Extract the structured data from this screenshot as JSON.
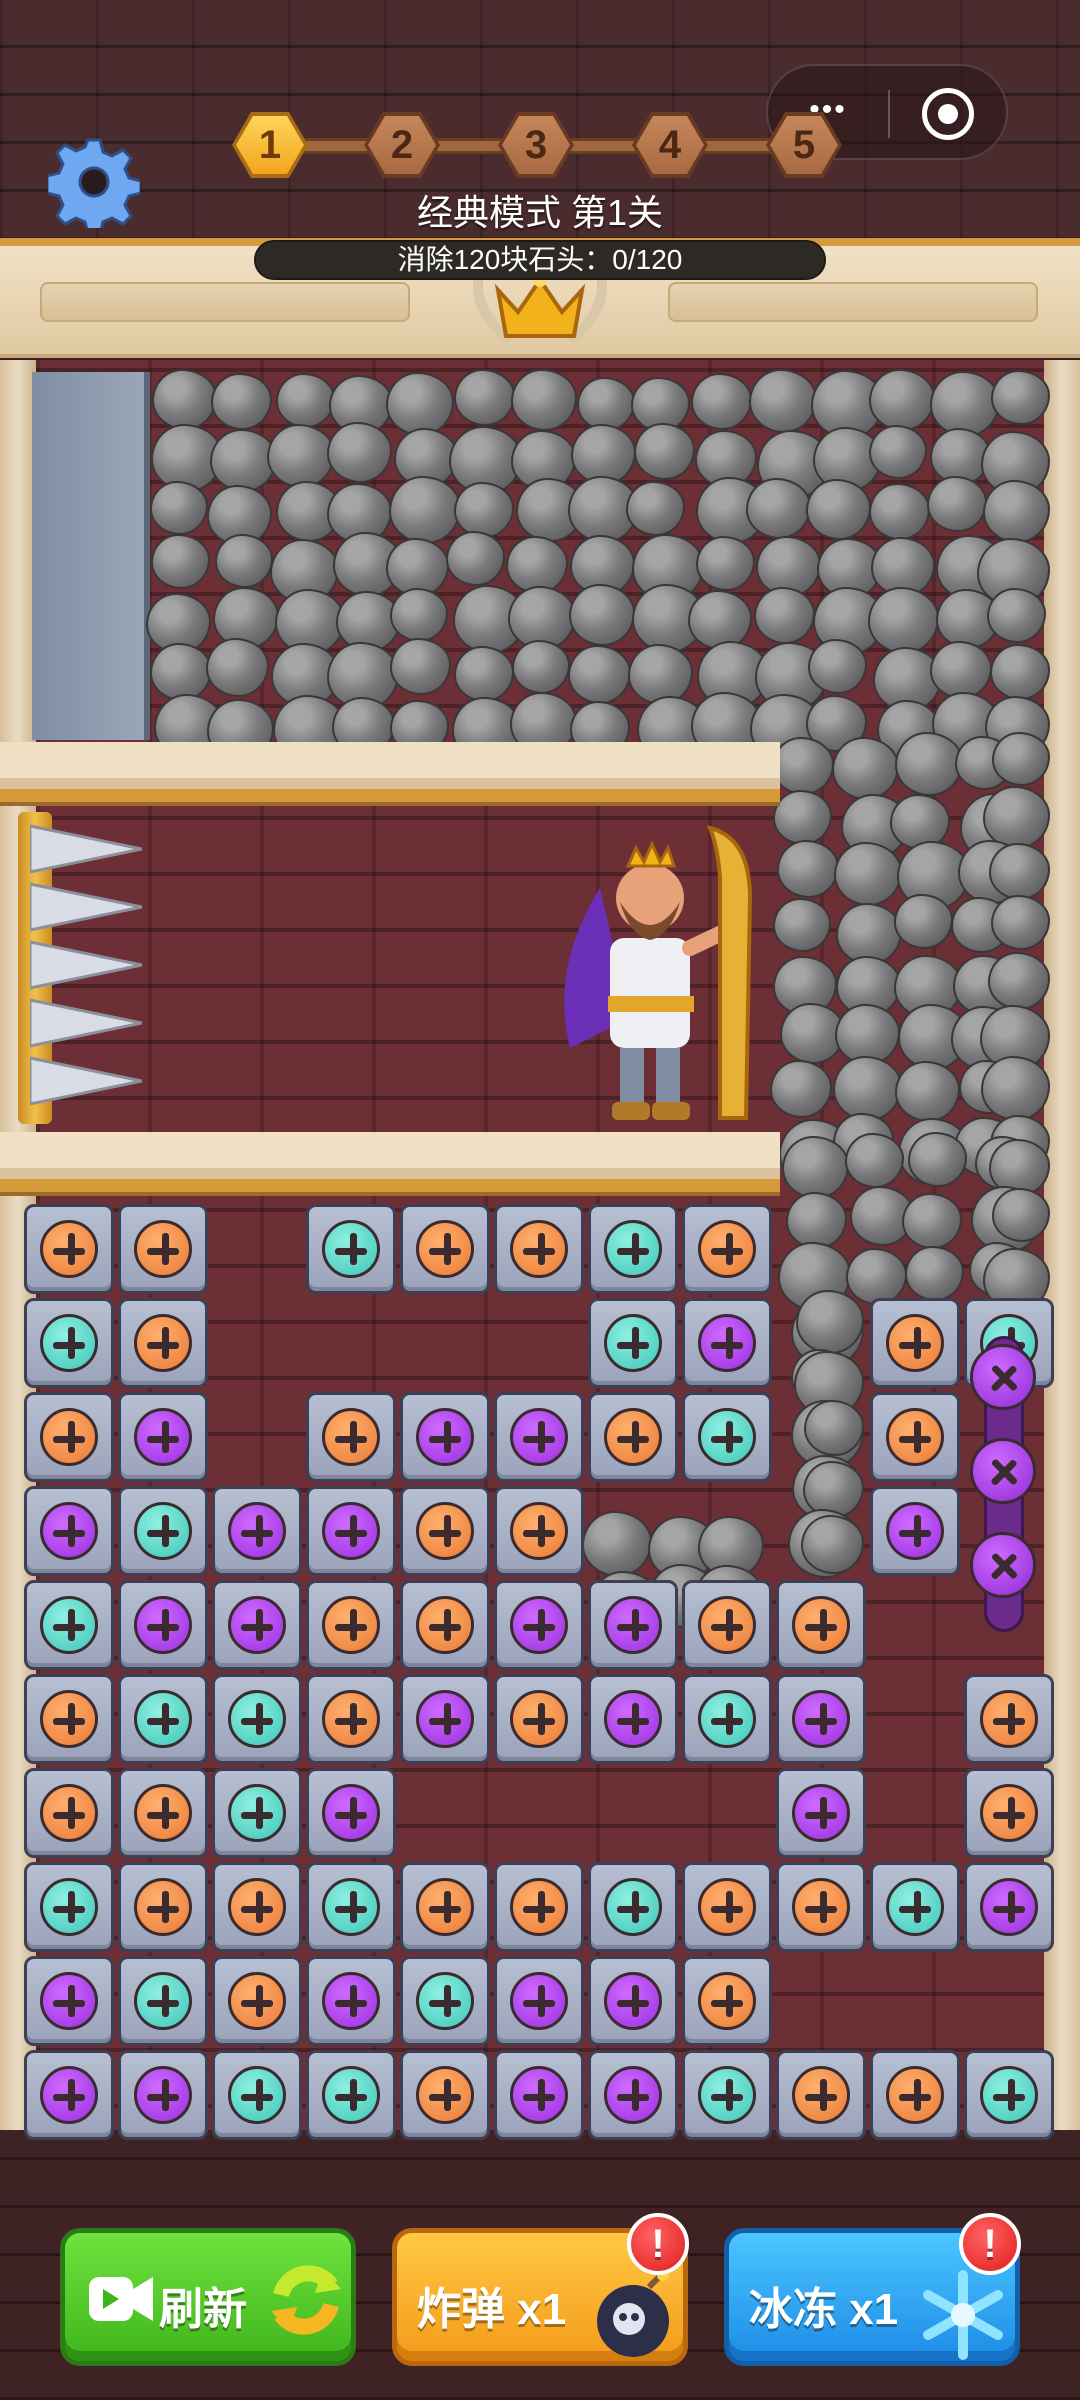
{
  "header": {
    "levels": [
      "1",
      "2",
      "3",
      "4",
      "5"
    ],
    "current_level": "1",
    "mode_title": "经典模式 第1关",
    "goal_text": "消除120块石头：0/120",
    "more_icon": "more-dots-icon",
    "close_icon": "target-close-icon",
    "settings_icon": "gear-icon"
  },
  "board": {
    "screw_colors": {
      "orange": "#ea7a36",
      "teal": "#3dc6b6",
      "purple": "#9a2fe0"
    },
    "rows": [
      [
        "orange",
        "orange",
        null,
        "teal",
        "orange",
        "orange",
        "teal",
        "orange",
        null,
        null,
        null
      ],
      [
        "teal",
        "orange",
        null,
        null,
        null,
        null,
        "teal",
        "purple",
        null,
        "orange",
        "teal"
      ],
      [
        "orange",
        "purple",
        null,
        "orange",
        "purple",
        "purple",
        "orange",
        "teal",
        null,
        "orange",
        null
      ],
      [
        "purple",
        "teal",
        "purple",
        "purple",
        "orange",
        "orange",
        null,
        null,
        null,
        "purple",
        null
      ],
      [
        "teal",
        "purple",
        "purple",
        "orange",
        "orange",
        "purple",
        "purple",
        "orange",
        "orange",
        null,
        null
      ],
      [
        "orange",
        "teal",
        "teal",
        "orange",
        "purple",
        "orange",
        "purple",
        "teal",
        "purple",
        null,
        "orange"
      ],
      [
        "orange",
        "orange",
        "teal",
        "purple",
        null,
        null,
        null,
        null,
        "purple",
        null,
        "orange"
      ],
      [
        "teal",
        "orange",
        "orange",
        "teal",
        "orange",
        "orange",
        "teal",
        "orange",
        "orange",
        "teal",
        "purple"
      ],
      [
        "purple",
        "teal",
        "orange",
        "purple",
        "teal",
        "purple",
        "purple",
        "orange",
        null,
        null,
        null
      ],
      [
        "purple",
        "purple",
        "teal",
        "teal",
        "orange",
        "purple",
        "purple",
        "teal",
        "orange",
        "orange",
        "teal"
      ]
    ],
    "loose_screws": 3
  },
  "actions": {
    "refresh_label": "刷新",
    "bomb_label": "炸弹 x1",
    "freeze_label": "冰冻 x1",
    "badge_text": "!"
  }
}
